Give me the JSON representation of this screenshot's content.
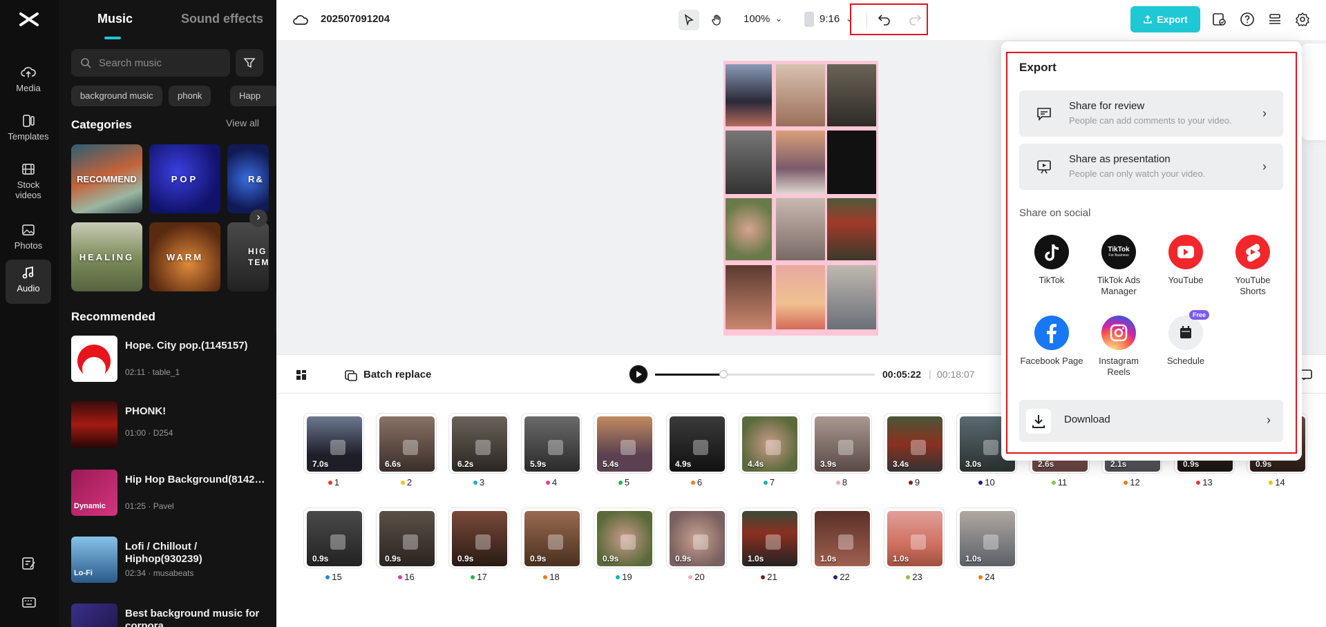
{
  "rail": {
    "items": [
      {
        "label": "Media",
        "icon": "cloud-upload-icon"
      },
      {
        "label": "Templates",
        "icon": "templates-icon"
      },
      {
        "label": "Stock\nvideos",
        "icon": "film-icon"
      },
      {
        "label": "Photos",
        "icon": "image-icon"
      },
      {
        "label": "Audio",
        "icon": "music-note-icon"
      }
    ]
  },
  "panel": {
    "tab_music": "Music",
    "tab_sfx": "Sound effects",
    "search_placeholder": "Search music",
    "chips": [
      "background music",
      "phonk",
      "Happ"
    ],
    "categories_title": "Categories",
    "view_all": "View all",
    "categories": [
      "RECOMMEND",
      "POP",
      "R&",
      "HEALING",
      "WARM",
      "HIG TEM"
    ],
    "recommended_title": "Recommended",
    "tracks": [
      {
        "title": "Hope. City pop.(1145157)",
        "meta": "02:11 · table_1"
      },
      {
        "title": "PHONK!",
        "meta": "01:00 · D254"
      },
      {
        "title": "Hip Hop Background(8142…",
        "meta": "01:25 · Pavel",
        "badge": "Dynamic"
      },
      {
        "title": "Lofi / Chillout / Hiphop(930239)",
        "meta": "02:34 · musabeats",
        "badge": "Lo-Fi"
      },
      {
        "title": "Best background music for corpora",
        "meta": ""
      }
    ]
  },
  "topbar": {
    "project_name": "202507091204",
    "zoom": "100%",
    "ratio": "9:16",
    "export_label": "Export"
  },
  "playbar": {
    "batch_replace": "Batch replace",
    "current_time": "00:05:22",
    "separator": "|",
    "total_time": "00:18:07",
    "progress": 0.31
  },
  "clips": [
    {
      "dur": "7.0s",
      "idx": "1",
      "dot": "#e53935"
    },
    {
      "dur": "6.6s",
      "idx": "2",
      "dot": "#f4c20d"
    },
    {
      "dur": "6.2s",
      "idx": "3",
      "dot": "#22a7e0"
    },
    {
      "dur": "5.9s",
      "idx": "4",
      "dot": "#e0409a"
    },
    {
      "dur": "5.4s",
      "idx": "5",
      "dot": "#2bb54a"
    },
    {
      "dur": "4.9s",
      "idx": "6",
      "dot": "#f07b1a"
    },
    {
      "dur": "4.4s",
      "idx": "7",
      "dot": "#12b5b0"
    },
    {
      "dur": "3.9s",
      "idx": "8",
      "dot": "#f3a6c3"
    },
    {
      "dur": "3.4s",
      "idx": "9",
      "dot": "#7a1f1f"
    },
    {
      "dur": "3.0s",
      "idx": "10",
      "dot": "#1a237e"
    },
    {
      "dur": "2.6s",
      "idx": "11",
      "dot": "#8bc34a"
    },
    {
      "dur": "2.1s",
      "idx": "12",
      "dot": "#f07b1a"
    },
    {
      "dur": "0.9s",
      "idx": "13",
      "dot": "#e53935"
    },
    {
      "dur": "0.9s",
      "idx": "14",
      "dot": "#f4c20d"
    },
    {
      "dur": "0.9s",
      "idx": "15",
      "dot": "#1e88e5"
    },
    {
      "dur": "0.9s",
      "idx": "16",
      "dot": "#e0409a"
    },
    {
      "dur": "0.9s",
      "idx": "17",
      "dot": "#2bb54a"
    },
    {
      "dur": "0.9s",
      "idx": "18",
      "dot": "#f07b1a"
    },
    {
      "dur": "0.9s",
      "idx": "19",
      "dot": "#12b5b0"
    },
    {
      "dur": "0.9s",
      "idx": "20",
      "dot": "#f3a6c3"
    },
    {
      "dur": "1.0s",
      "idx": "21",
      "dot": "#7a1f1f"
    },
    {
      "dur": "1.0s",
      "idx": "22",
      "dot": "#1a237e"
    },
    {
      "dur": "1.0s",
      "idx": "23",
      "dot": "#8bc34a"
    },
    {
      "dur": "1.0s",
      "idx": "24",
      "dot": "#f07b1a"
    }
  ],
  "export_popover": {
    "title": "Export",
    "share_review_title": "Share for review",
    "share_review_sub": "People can add comments to your video.",
    "share_presentation_title": "Share as presentation",
    "share_presentation_sub": "People can only watch your video.",
    "social_label": "Share on social",
    "socials": [
      {
        "label": "TikTok",
        "icon": "tiktok-icon"
      },
      {
        "label": "TikTok Ads Manager",
        "icon": "tiktok-ads-icon"
      },
      {
        "label": "YouTube",
        "icon": "youtube-icon"
      },
      {
        "label": "YouTube Shorts",
        "icon": "youtube-shorts-icon"
      },
      {
        "label": "Facebook Page",
        "icon": "facebook-icon"
      },
      {
        "label": "Instagram Reels",
        "icon": "instagram-icon"
      },
      {
        "label": "Schedule",
        "icon": "calendar-icon",
        "badge": "Free"
      }
    ],
    "tiktok_ads_mark": "TikTok",
    "tiktok_ads_sub": "For Business",
    "download_label": "Download"
  },
  "colors": {
    "accent": "#1fc8d4",
    "highlight_border": "#e0131a",
    "panel_bg": "#141414"
  }
}
